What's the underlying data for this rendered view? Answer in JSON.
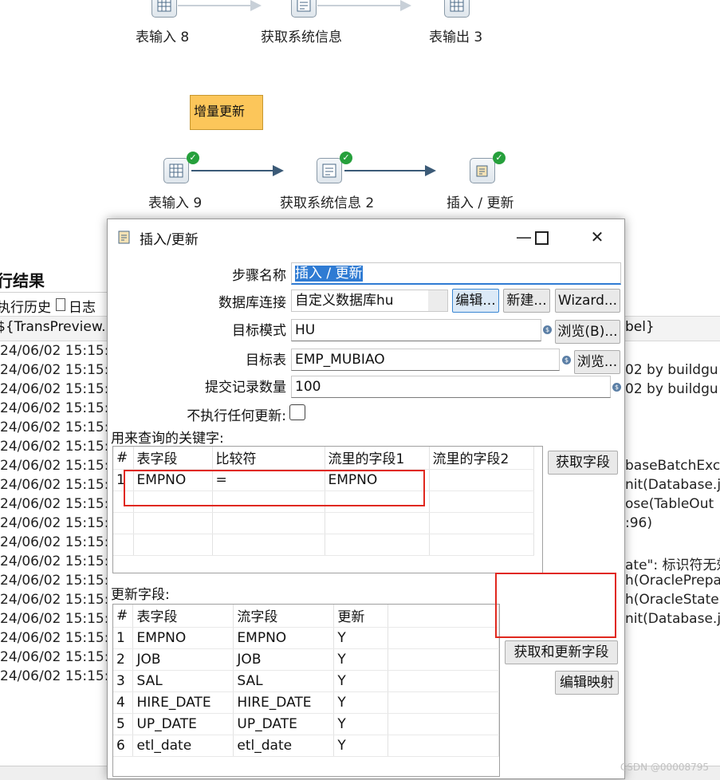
{
  "canvas": {
    "top_row": [
      {
        "label": "表输入 8"
      },
      {
        "label": "获取系统信息"
      },
      {
        "label": "表输出 3"
      }
    ],
    "note": "增量更新",
    "flow": [
      {
        "label": "表输入 9"
      },
      {
        "label": "获取系统信息 2"
      },
      {
        "label": "插入 / 更新"
      }
    ],
    "hop_color_active": "#3b5a77",
    "hop_color_inactive": "#c8d0d8"
  },
  "background_panel": {
    "title": "行结果",
    "tabs": [
      "执行历史",
      "日志"
    ],
    "header_left": "${TransPreview.F",
    "header_right": "bel}",
    "timestamps": [
      "24/06/02 15:15:",
      "24/06/02 15:15:",
      "24/06/02 15:15:",
      "24/06/02 15:15:",
      "24/06/02 15:15:",
      "24/06/02 15:15:",
      "24/06/02 15:15:",
      "24/06/02 15:15:",
      "24/06/02 15:15:",
      "24/06/02 15:15:",
      "24/06/02 15:15:",
      "24/06/02 15:15:",
      "24/06/02 15:15:",
      "24/06/02 15:15:",
      "24/06/02 15:15:",
      "24/06/02 15:15:",
      "24/06/02 15:15:",
      "24/06/02 15:15:"
    ],
    "right_lines": [
      "02 by buildgu",
      "02 by buildgu",
      "baseBatchExc",
      "nit(Database.ja",
      "ose(TableOut",
      ":96)",
      "ate\": 标识符无效",
      "h(OraclePrepa",
      "h(OracleStater",
      "nit(Database.ja"
    ]
  },
  "dialog": {
    "title": "插入/更新",
    "step_name_label": "步骤名称",
    "step_name_value": "插入 / 更新",
    "db_conn_label": "数据库连接",
    "db_conn_value": "自定义数据库hu",
    "edit_btn": "编辑...",
    "new_btn": "新建...",
    "wizard_btn": "Wizard...",
    "schema_label": "目标模式",
    "schema_value": "HU",
    "browse_btn_1": "浏览(B)...",
    "table_label": "目标表",
    "table_value": "EMP_MUBIAO",
    "browse_btn_2": "浏览...",
    "commit_label": "提交记录数量",
    "commit_value": "100",
    "no_update_label": "不执行任何更新:",
    "keys_label": "用来查询的关键字:",
    "keys_columns": [
      "#",
      "表字段",
      "比较符",
      "流里的字段1",
      "流里的字段2"
    ],
    "keys_rows": [
      {
        "num": "1",
        "table_field": "EMPNO",
        "comparator": "=",
        "stream_field1": "EMPNO",
        "stream_field2": ""
      }
    ],
    "get_fields_btn": "获取字段",
    "update_label": "更新字段:",
    "update_columns": [
      "#",
      "表字段",
      "流字段",
      "更新"
    ],
    "update_rows": [
      {
        "num": "1",
        "table_field": "EMPNO",
        "stream_field": "EMPNO",
        "update": "Y"
      },
      {
        "num": "2",
        "table_field": "JOB",
        "stream_field": "JOB",
        "update": "Y"
      },
      {
        "num": "3",
        "table_field": "SAL",
        "stream_field": "SAL",
        "update": "Y"
      },
      {
        "num": "4",
        "table_field": "HIRE_DATE",
        "stream_field": "HIRE_DATE",
        "update": "Y"
      },
      {
        "num": "5",
        "table_field": "UP_DATE",
        "stream_field": "UP_DATE",
        "update": "Y"
      },
      {
        "num": "6",
        "table_field": "etl_date",
        "stream_field": "etl_date",
        "update": "Y"
      }
    ],
    "get_update_btn": "获取和更新字段",
    "edit_mapping_btn": "编辑映射",
    "highlight_color": "#e0281e",
    "selection_color": "#2f7bd3"
  },
  "watermark": "CSDN @00008795"
}
